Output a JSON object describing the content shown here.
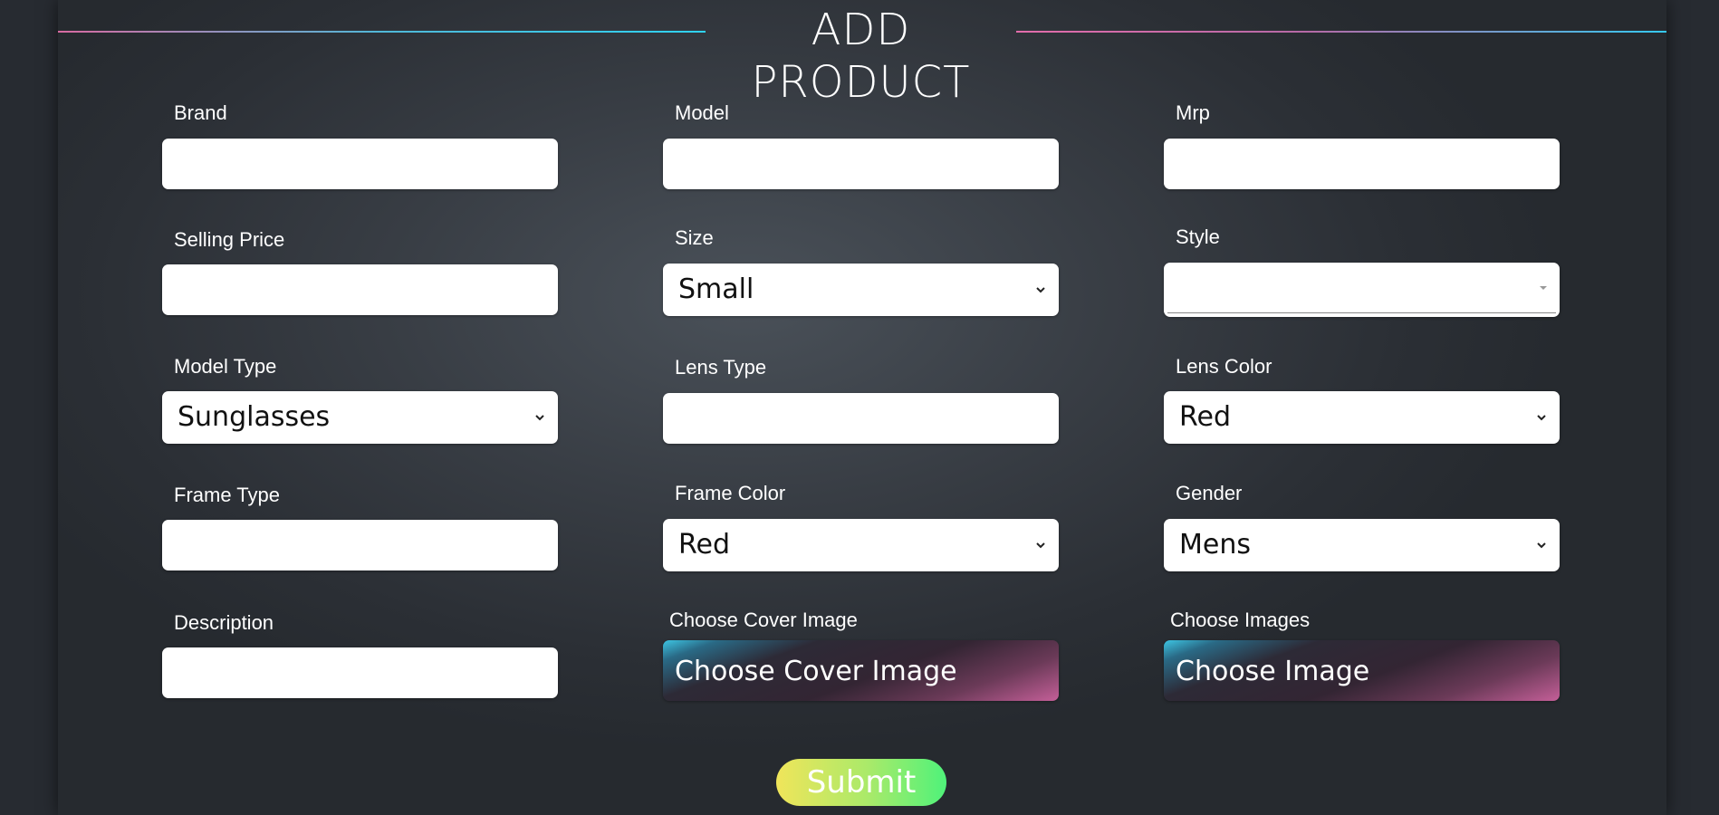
{
  "page": {
    "title": "ADD PRODUCT"
  },
  "form": {
    "brand": {
      "label": "Brand",
      "value": ""
    },
    "model": {
      "label": "Model",
      "value": ""
    },
    "mrp": {
      "label": "Mrp",
      "value": ""
    },
    "selling_price": {
      "label": "Selling Price",
      "value": ""
    },
    "size": {
      "label": "Size",
      "value": "Small"
    },
    "style": {
      "label": "Style",
      "value": ""
    },
    "model_type": {
      "label": "Model Type",
      "value": "Sunglasses"
    },
    "lens_type": {
      "label": "Lens Type",
      "value": ""
    },
    "lens_color": {
      "label": "Lens Color",
      "value": "Red"
    },
    "frame_type": {
      "label": "Frame Type",
      "value": ""
    },
    "frame_color": {
      "label": "Frame Color",
      "value": "Red"
    },
    "gender": {
      "label": "Gender",
      "value": "Mens"
    },
    "description": {
      "label": "Description",
      "value": ""
    },
    "cover_image": {
      "label": "Choose Cover Image",
      "button": "Choose Cover Image"
    },
    "images": {
      "label": "Choose Images",
      "button": "Choose Image"
    },
    "submit": "Submit"
  },
  "colors": {
    "background": "#272b31",
    "submit_gradient_start": "#f0e55a",
    "submit_gradient_end": "#4ff27a",
    "accent_cyan": "#2fd3f1",
    "accent_pink": "#e36dab"
  },
  "icons": {
    "select_arrow": "chevron-down-icon",
    "multiselect_arrow": "caret-down-icon"
  }
}
